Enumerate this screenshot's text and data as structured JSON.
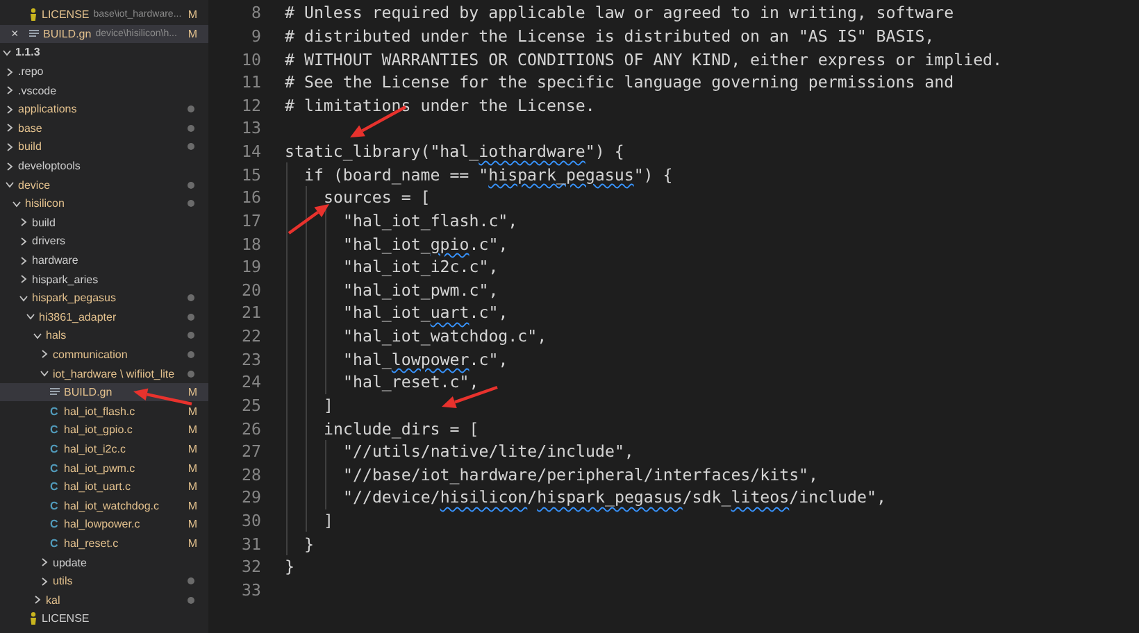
{
  "open_editors": [
    {
      "name": "LICENSE",
      "path": "base\\iot_hardware...",
      "kind": "license",
      "badge": "M",
      "selected": false
    },
    {
      "name": "BUILD.gn",
      "path": "device\\hisilicon\\h...",
      "kind": "gn",
      "badge": "M",
      "selected": true,
      "close": "×"
    }
  ],
  "explorer": {
    "name": "1.1.3",
    "expanded": true,
    "children": [
      {
        "name": ".repo",
        "kind": "folder",
        "expanded": false,
        "dot": false,
        "selected": false
      },
      {
        "name": ".vscode",
        "kind": "folder",
        "expanded": false,
        "dot": false,
        "selected": false
      },
      {
        "name": "applications",
        "kind": "folder",
        "expanded": false,
        "dot": true,
        "selected": false
      },
      {
        "name": "base",
        "kind": "folder",
        "expanded": false,
        "dot": true,
        "selected": false
      },
      {
        "name": "build",
        "kind": "folder",
        "expanded": false,
        "dot": true,
        "selected": false
      },
      {
        "name": "developtools",
        "kind": "folder",
        "expanded": false,
        "dot": false,
        "selected": false
      },
      {
        "name": "device",
        "kind": "folder",
        "expanded": true,
        "dot": true,
        "selected": false,
        "children": [
          {
            "name": "hisilicon",
            "kind": "folder",
            "expanded": true,
            "dot": true,
            "selected": false,
            "children": [
              {
                "name": "build",
                "kind": "folder",
                "expanded": false,
                "dot": false,
                "selected": false
              },
              {
                "name": "drivers",
                "kind": "folder",
                "expanded": false,
                "dot": false,
                "selected": false
              },
              {
                "name": "hardware",
                "kind": "folder",
                "expanded": false,
                "dot": false,
                "selected": false
              },
              {
                "name": "hispark_aries",
                "kind": "folder",
                "expanded": false,
                "dot": false,
                "selected": false
              },
              {
                "name": "hispark_pegasus",
                "kind": "folder",
                "expanded": true,
                "dot": true,
                "selected": false,
                "children": [
                  {
                    "name": "hi3861_adapter",
                    "kind": "folder",
                    "expanded": true,
                    "dot": true,
                    "selected": false,
                    "children": [
                      {
                        "name": "hals",
                        "kind": "folder",
                        "expanded": true,
                        "dot": true,
                        "selected": false,
                        "children": [
                          {
                            "name": "communication",
                            "kind": "folder",
                            "expanded": false,
                            "dot": true,
                            "selected": false
                          },
                          {
                            "name": "iot_hardware \\ wifiiot_lite",
                            "kind": "folder",
                            "expanded": true,
                            "dot": true,
                            "selected": false,
                            "children": [
                              {
                                "name": "BUILD.gn",
                                "kind": "gn",
                                "badge": "M",
                                "selected": true
                              },
                              {
                                "name": "hal_iot_flash.c",
                                "kind": "c",
                                "icon": "C",
                                "badge": "M",
                                "selected": false
                              },
                              {
                                "name": "hal_iot_gpio.c",
                                "kind": "c",
                                "icon": "C",
                                "badge": "M",
                                "selected": false
                              },
                              {
                                "name": "hal_iot_i2c.c",
                                "kind": "c",
                                "icon": "C",
                                "badge": "M",
                                "selected": false
                              },
                              {
                                "name": "hal_iot_pwm.c",
                                "kind": "c",
                                "icon": "C",
                                "badge": "M",
                                "selected": false
                              },
                              {
                                "name": "hal_iot_uart.c",
                                "kind": "c",
                                "icon": "C",
                                "badge": "M",
                                "selected": false
                              },
                              {
                                "name": "hal_iot_watchdog.c",
                                "kind": "c",
                                "icon": "C",
                                "badge": "M",
                                "selected": false
                              },
                              {
                                "name": "hal_lowpower.c",
                                "kind": "c",
                                "icon": "C",
                                "badge": "M",
                                "selected": false
                              },
                              {
                                "name": "hal_reset.c",
                                "kind": "c",
                                "icon": "C",
                                "badge": "M",
                                "selected": false
                              }
                            ]
                          },
                          {
                            "name": "update",
                            "kind": "folder",
                            "expanded": false,
                            "dot": false,
                            "selected": false
                          },
                          {
                            "name": "utils",
                            "kind": "folder",
                            "expanded": false,
                            "dot": true,
                            "selected": false
                          }
                        ]
                      },
                      {
                        "name": "kal",
                        "kind": "folder",
                        "expanded": false,
                        "dot": true,
                        "selected": false
                      }
                    ]
                  },
                  {
                    "name": "LICENSE",
                    "kind": "license",
                    "selected": false
                  }
                ]
              }
            ]
          }
        ]
      }
    ]
  },
  "editor": {
    "lines": [
      {
        "number": "8",
        "parts": [
          {
            "text": "# Unless required by applicable law or agreed to in writing, software",
            "squiggle": false
          }
        ]
      },
      {
        "number": "9",
        "parts": [
          {
            "text": "# distributed under the License is distributed on an \"AS IS\" BASIS,",
            "squiggle": false
          }
        ]
      },
      {
        "number": "10",
        "parts": [
          {
            "text": "# WITHOUT WARRANTIES OR CONDITIONS OF ANY KIND, either express or implied.",
            "squiggle": false
          }
        ]
      },
      {
        "number": "11",
        "parts": [
          {
            "text": "# See the License for the specific language governing permissions and",
            "squiggle": false
          }
        ]
      },
      {
        "number": "12",
        "parts": [
          {
            "text": "# limitations under the License.",
            "squiggle": false
          }
        ]
      },
      {
        "number": "13"
      },
      {
        "number": "14",
        "parts": [
          {
            "text": "static_library(\"hal_",
            "squiggle": false
          },
          {
            "text": "iothardware",
            "squiggle": true
          },
          {
            "text": "\") {",
            "squiggle": false
          }
        ]
      },
      {
        "number": "15",
        "parts": [
          {
            "text": "  if (board_name == \"",
            "squiggle": false
          },
          {
            "text": "hispark_pegasus",
            "squiggle": true
          },
          {
            "text": "\") {",
            "squiggle": false
          }
        ]
      },
      {
        "number": "16",
        "parts": [
          {
            "text": "    sources = [",
            "squiggle": false
          }
        ]
      },
      {
        "number": "17",
        "parts": [
          {
            "text": "      \"hal_iot_flash.c\",",
            "squiggle": false
          }
        ]
      },
      {
        "number": "18",
        "parts": [
          {
            "text": "      \"hal_iot_",
            "squiggle": false
          },
          {
            "text": "gpio",
            "squiggle": true
          },
          {
            "text": ".c\",",
            "squiggle": false
          }
        ]
      },
      {
        "number": "19",
        "parts": [
          {
            "text": "      \"hal_iot_i2c.c\",",
            "squiggle": false
          }
        ]
      },
      {
        "number": "20",
        "parts": [
          {
            "text": "      \"hal_iot_pwm.c\",",
            "squiggle": false
          }
        ]
      },
      {
        "number": "21",
        "parts": [
          {
            "text": "      \"hal_iot_",
            "squiggle": false
          },
          {
            "text": "uart",
            "squiggle": true
          },
          {
            "text": ".c\",",
            "squiggle": false
          }
        ]
      },
      {
        "number": "22",
        "parts": [
          {
            "text": "      \"hal_iot_watchdog.c\",",
            "squiggle": false
          }
        ]
      },
      {
        "number": "23",
        "parts": [
          {
            "text": "      \"hal_",
            "squiggle": false
          },
          {
            "text": "lowpower",
            "squiggle": true
          },
          {
            "text": ".c\",",
            "squiggle": false
          }
        ]
      },
      {
        "number": "24",
        "parts": [
          {
            "text": "      \"hal_reset.c\",",
            "squiggle": false
          }
        ]
      },
      {
        "number": "25",
        "parts": [
          {
            "text": "    ]",
            "squiggle": false
          }
        ]
      },
      {
        "number": "26",
        "parts": [
          {
            "text": "    include_dirs = [",
            "squiggle": false
          }
        ]
      },
      {
        "number": "27",
        "parts": [
          {
            "text": "      \"//utils/native/lite/include\",",
            "squiggle": false
          }
        ]
      },
      {
        "number": "28",
        "parts": [
          {
            "text": "      \"//base/iot_hardware/peripheral/interfaces/kits\",",
            "squiggle": false
          }
        ]
      },
      {
        "number": "29",
        "parts": [
          {
            "text": "      \"//device/",
            "squiggle": false
          },
          {
            "text": "hisilicon",
            "squiggle": true
          },
          {
            "text": "/",
            "squiggle": false
          },
          {
            "text": "hispark_pegasus",
            "squiggle": true
          },
          {
            "text": "/sdk_",
            "squiggle": false
          },
          {
            "text": "liteos",
            "squiggle": true
          },
          {
            "text": "/include\",",
            "squiggle": false
          }
        ]
      },
      {
        "number": "30",
        "parts": [
          {
            "text": "    ]",
            "squiggle": false
          }
        ]
      },
      {
        "number": "31",
        "parts": [
          {
            "text": "  }",
            "squiggle": false
          }
        ]
      },
      {
        "number": "32",
        "parts": [
          {
            "text": "}",
            "squiggle": false
          }
        ]
      },
      {
        "number": "33"
      }
    ]
  },
  "annotations": [
    {
      "kind": "arrow"
    },
    {
      "kind": "arrow"
    },
    {
      "kind": "arrow"
    },
    {
      "kind": "arrow"
    }
  ]
}
